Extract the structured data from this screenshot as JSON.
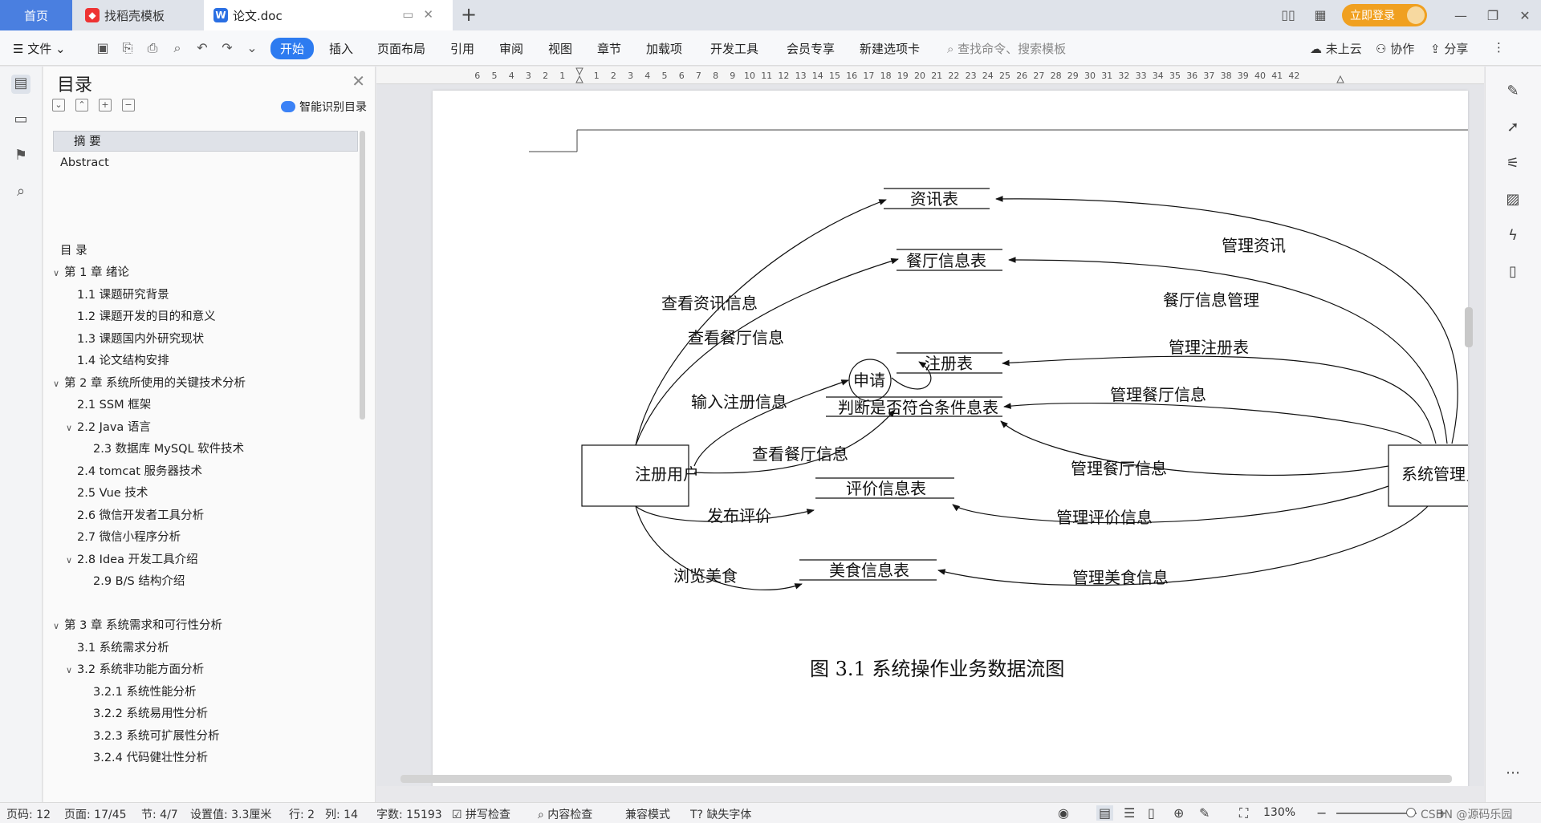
{
  "tabs": {
    "home": "首页",
    "template": "找稻壳模板",
    "doc": "论文.doc"
  },
  "topbar": {
    "login": "立即登录"
  },
  "ribbon": {
    "file": "文件",
    "tabs": [
      "开始",
      "插入",
      "页面布局",
      "引用",
      "审阅",
      "视图",
      "章节",
      "加载项",
      "开发工具",
      "会员专享",
      "新建选项卡"
    ],
    "search_placeholder": "查找命令、搜索模板",
    "cloud": "未上云",
    "collab": "协作",
    "share": "分享"
  },
  "toc": {
    "title": "目录",
    "smart": "智能识别目录",
    "items": [
      {
        "label": "摘 要",
        "level": 1
      },
      {
        "label": "Abstract",
        "level": 0
      },
      {
        "label": "目 录",
        "level": 0
      },
      {
        "label": "第 1 章  绪论",
        "level": 0
      },
      {
        "label": "1.1    课题研究背景",
        "level": 1
      },
      {
        "label": "1.2  课题开发的目的和意义",
        "level": 1
      },
      {
        "label": "1.3    课题国内外研究现状",
        "level": 1
      },
      {
        "label": "1.4  论文结构安排",
        "level": 1
      },
      {
        "label": "第 2 章  系统所使用的关键技术分析",
        "level": 0
      },
      {
        "label": "2.1 SSM 框架",
        "level": 1
      },
      {
        "label": "2.2 Java 语言",
        "level": 1
      },
      {
        "label": "2.3  数据库 MySQL 软件技术",
        "level": 2
      },
      {
        "label": "2.4 tomcat 服务器技术",
        "level": 1
      },
      {
        "label": "2.5 Vue 技术",
        "level": 1
      },
      {
        "label": "2.6  微信开发者工具分析",
        "level": 1
      },
      {
        "label": "2.7 微信小程序分析",
        "level": 1
      },
      {
        "label": "2.8 Idea 开发工具介绍",
        "level": 1
      },
      {
        "label": "2.9 B/S 结构介绍",
        "level": 2
      },
      {
        "label": "第 3 章  系统需求和可行性分析",
        "level": 0
      },
      {
        "label": "3.1 系统需求分析",
        "level": 1
      },
      {
        "label": "3.2 系统非功能方面分析",
        "level": 1
      },
      {
        "label": "3.2.1 系统性能分析",
        "level": 2
      },
      {
        "label": "3.2.2 系统易用性分析",
        "level": 2
      },
      {
        "label": "3.2.3 系统可扩展性分析",
        "level": 2
      },
      {
        "label": "3.2.4 代码健壮性分析",
        "level": 2
      }
    ]
  },
  "ruler": {
    "left_ticks": [
      "6",
      "5",
      "4",
      "3",
      "2",
      "1"
    ],
    "right_ticks": [
      "1",
      "2",
      "3",
      "4",
      "5",
      "6",
      "7",
      "8",
      "9",
      "10",
      "11",
      "12",
      "13",
      "14",
      "15",
      "16",
      "17",
      "18",
      "19",
      "20",
      "21",
      "22",
      "23",
      "24",
      "25",
      "26",
      "27",
      "28",
      "29",
      "30",
      "31",
      "32",
      "33",
      "34",
      "35",
      "36",
      "37",
      "38",
      "39",
      "40",
      "41",
      "42"
    ]
  },
  "diagram": {
    "entities": {
      "user": "注册用户",
      "admin": "系统管理员"
    },
    "process": "申请",
    "stores": {
      "news": "资讯表",
      "restaurant": "餐厅信息表",
      "register": "注册表",
      "check": "判断是否符合条件息表",
      "review": "评价信息表",
      "food": "美食信息表"
    },
    "labels": {
      "view_news": "查看资讯信息",
      "view_rest1": "查看餐厅信息",
      "input_reg": "输入注册信息",
      "view_rest2": "查看餐厅信息",
      "post_review": "发布评价",
      "browse_food": "浏览美食",
      "manage_news": "管理资讯",
      "rest_manage": "餐厅信息管理",
      "manage_reg": "管理注册表",
      "manage_rest1": "管理餐厅信息",
      "manage_rest2": "管理餐厅信息",
      "manage_review": "管理评价信息",
      "manage_food": "管理美食信息"
    },
    "caption": "图 3.1 系统操作业务数据流图"
  },
  "status": {
    "page": "页码: 12",
    "pages": "页面: 17/45",
    "section": "节: 4/7",
    "setting": "设置值: 3.3厘米",
    "row": "行: 2",
    "col": "列: 14",
    "words": "字数: 15193",
    "spell": "拼写检查",
    "content": "内容检查",
    "compat": "兼容模式",
    "font_missing": "缺失字体",
    "zoom": "130%",
    "watermark": "CSDN @源码乐园"
  }
}
